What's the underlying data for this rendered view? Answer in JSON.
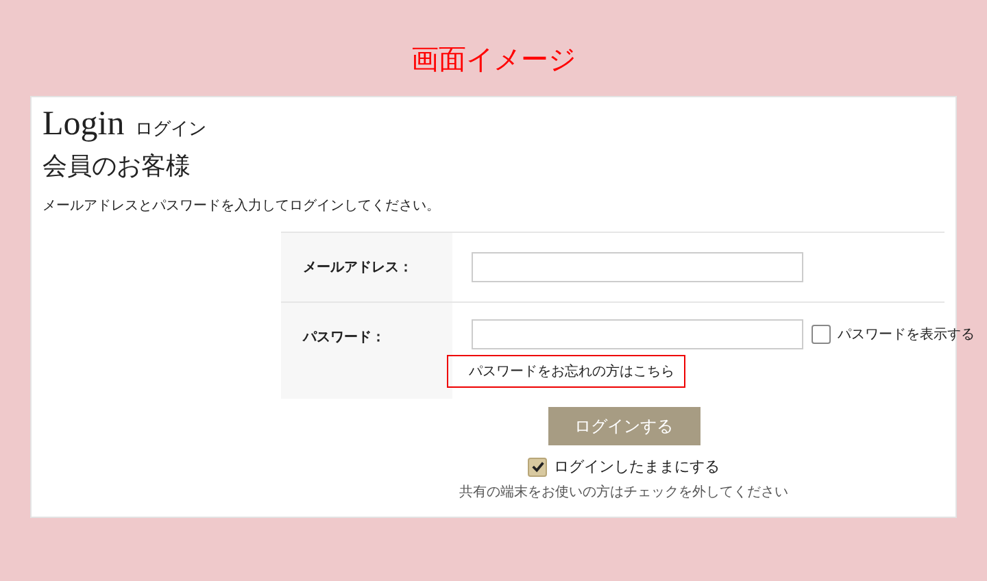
{
  "banner": {
    "title": "画面イメージ"
  },
  "heading": {
    "title": "Login",
    "subtitle": "ログイン"
  },
  "section": {
    "title": "会員のお客様",
    "description": "メールアドレスとパスワードを入力してログインしてください。"
  },
  "form": {
    "fields": [
      {
        "label": "メールアドレス："
      },
      {
        "label": "パスワード：",
        "show_password": {
          "label": "パスワードを表示する",
          "checked": false
        },
        "forgot_link": "パスワードをお忘れの方はこちら",
        "highlighted": true
      }
    ]
  },
  "login_button": "ログインする",
  "remember": {
    "label": "ログインしたままにする",
    "checked": true
  },
  "note": "共有の端末をお使いの方はチェックを外してください"
}
